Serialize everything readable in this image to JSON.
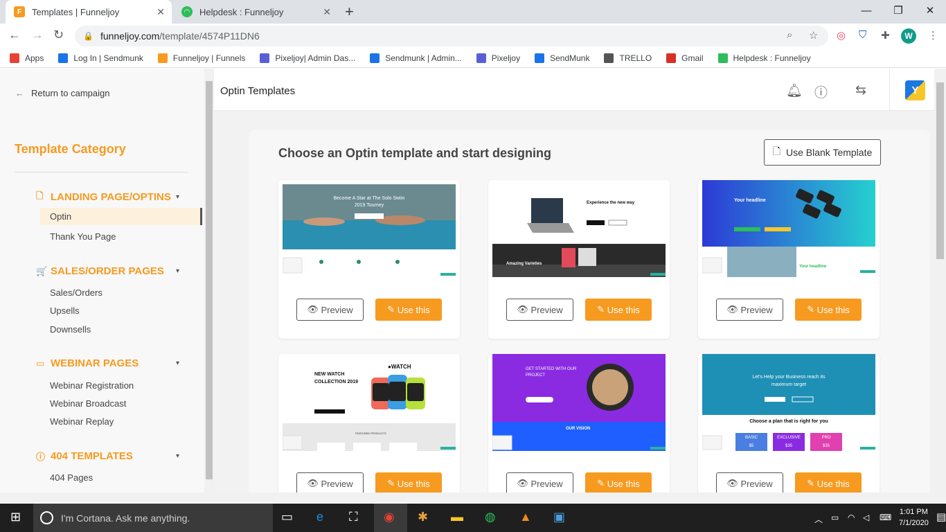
{
  "browser": {
    "tabs": [
      {
        "title": "Templates | Funneljoy",
        "icon": "funneljoy-favicon",
        "color": "#f79a20",
        "active": true
      },
      {
        "title": "Helpdesk : Funneljoy",
        "icon": "helpdesk-favicon",
        "color": "#2ebd59",
        "active": false
      }
    ],
    "url_domain": "funneljoy.com",
    "url_path": "/template/4574P11DN6",
    "profile_initial": "W",
    "bookmarks": [
      {
        "label": "Apps",
        "icon": "apps-grid-icon",
        "color": "#e94235"
      },
      {
        "label": "Log In | Sendmunk",
        "icon": "sendmunk-icon",
        "color": "#1a73e8"
      },
      {
        "label": "Funneljoy | Funnels",
        "icon": "funneljoy-favicon",
        "color": "#f79a20"
      },
      {
        "label": "Pixeljoy| Admin Das...",
        "icon": "pixeljoy-icon",
        "color": "#5b5fd6"
      },
      {
        "label": "Sendmunk | Admin...",
        "icon": "sendmunk-icon",
        "color": "#1a73e8"
      },
      {
        "label": "Pixeljoy",
        "icon": "pixeljoy-icon",
        "color": "#5b5fd6"
      },
      {
        "label": "SendMunk",
        "icon": "sendmunk-icon",
        "color": "#1a73e8"
      },
      {
        "label": "TRELLO",
        "icon": "trello-icon",
        "color": "#555555"
      },
      {
        "label": "Gmail",
        "icon": "gmail-icon",
        "color": "#d93025"
      },
      {
        "label": "Helpdesk : Funneljoy",
        "icon": "helpdesk-favicon",
        "color": "#2ebd59"
      }
    ]
  },
  "sidebar": {
    "return_label": "Return to campaign",
    "category_title": "Template Category",
    "sections": [
      {
        "label": "LANDING PAGE/OPTINS",
        "icon": "page-icon",
        "items": [
          "Optin",
          "Thank You Page"
        ]
      },
      {
        "label": "SALES/ORDER PAGES",
        "icon": "cart-icon",
        "items": [
          "Sales/Orders",
          "Upsells",
          "Downsells"
        ]
      },
      {
        "label": "WEBINAR PAGES",
        "icon": "video-icon",
        "items": [
          "Webinar Registration",
          "Webinar Broadcast",
          "Webinar Replay"
        ]
      },
      {
        "label": "404 TEMPLATES",
        "icon": "info-icon",
        "items": [
          "404 Pages"
        ]
      }
    ],
    "selected_item": "Optin"
  },
  "header": {
    "title": "Optin Templates"
  },
  "panel": {
    "heading": "Choose an Optin template and start designing",
    "blank_button": "Use Blank Template",
    "preview_label": "Preview",
    "use_label": "Use this",
    "templates": [
      {
        "title": "Become A Star at The Solo Swim 2019 Tourney"
      },
      {
        "title": "Experience the new way",
        "sub": "Amazing Varieties"
      },
      {
        "title": "Your headline",
        "sub": "Your headline"
      },
      {
        "title": "NEW WATCH COLLECTION 2019",
        "sub": "FEATURED PRODUCTS",
        "brand": "WATCH"
      },
      {
        "title": "GET STARTED WITH OUR PROJECT",
        "sub": "OUR VISION"
      },
      {
        "title": "Let's Help your Business reach its maximum target",
        "sub": "Choose a plan that is right for you",
        "plans": [
          "BASIC",
          "EXCLUSIVE",
          "PRO"
        ],
        "prices": [
          "$5",
          "$35",
          "$35"
        ]
      }
    ]
  },
  "taskbar": {
    "cortana": "I'm Cortana. Ask me anything.",
    "time": "1:01 PM",
    "date": "7/1/2020"
  },
  "colors": {
    "accent": "#f79a20"
  }
}
